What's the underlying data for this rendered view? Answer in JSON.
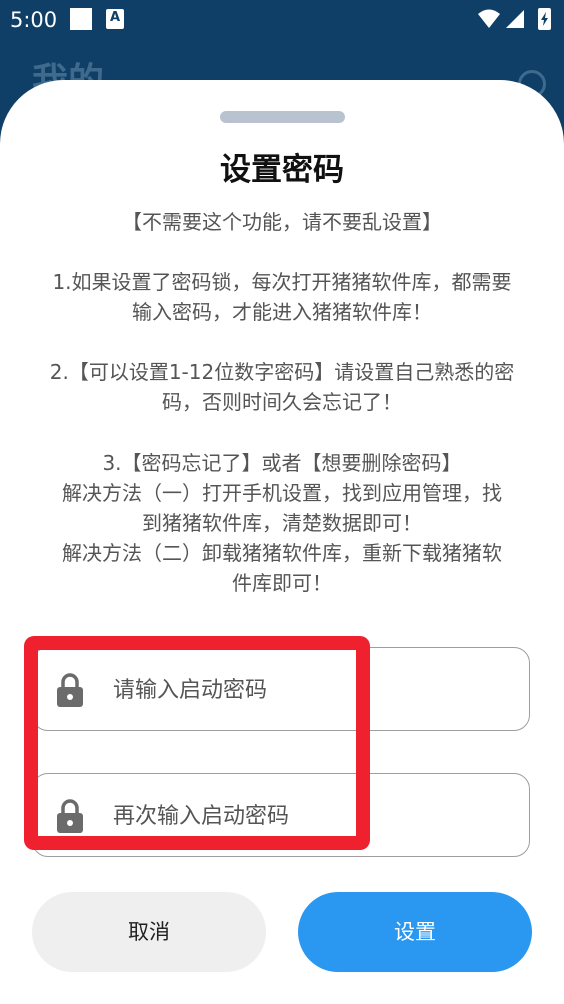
{
  "status_bar": {
    "time": "5:00",
    "a_badge": "A",
    "icons": [
      "square-icon",
      "a-notification-icon",
      "wifi-icon",
      "signal-icon",
      "battery-charging-icon"
    ]
  },
  "background": {
    "title": "我的"
  },
  "dialog": {
    "title": "设置密码",
    "paragraphs": [
      "【不需要这个功能，请不要乱设置】",
      "1.如果设置了密码锁，每次打开猪猪软件库，都需要\n输入密码，才能进入猪猪软件库！",
      "2.【可以设置1-12位数字密码】请设置自己熟悉的密\n码，否则时间久会忘记了！",
      "3.【密码忘记了】或者【想要删除密码】\n解决方法（一）打开手机设置，找到应用管理，找\n到猪猪软件库，清楚数据即可！\n解决方法（二）卸载猪猪软件库，重新下载猪猪软\n件库即可！"
    ],
    "password_field": {
      "placeholder": "请输入启动密码",
      "value": "",
      "icon": "lock-icon"
    },
    "confirm_field": {
      "placeholder": "再次输入启动密码",
      "value": "",
      "icon": "lock-icon"
    },
    "cancel_label": "取消",
    "confirm_label": "设置"
  },
  "colors": {
    "status_bar_bg": "#0f3f66",
    "primary_button": "#2a97f0",
    "highlight_box": "#f0212f"
  }
}
